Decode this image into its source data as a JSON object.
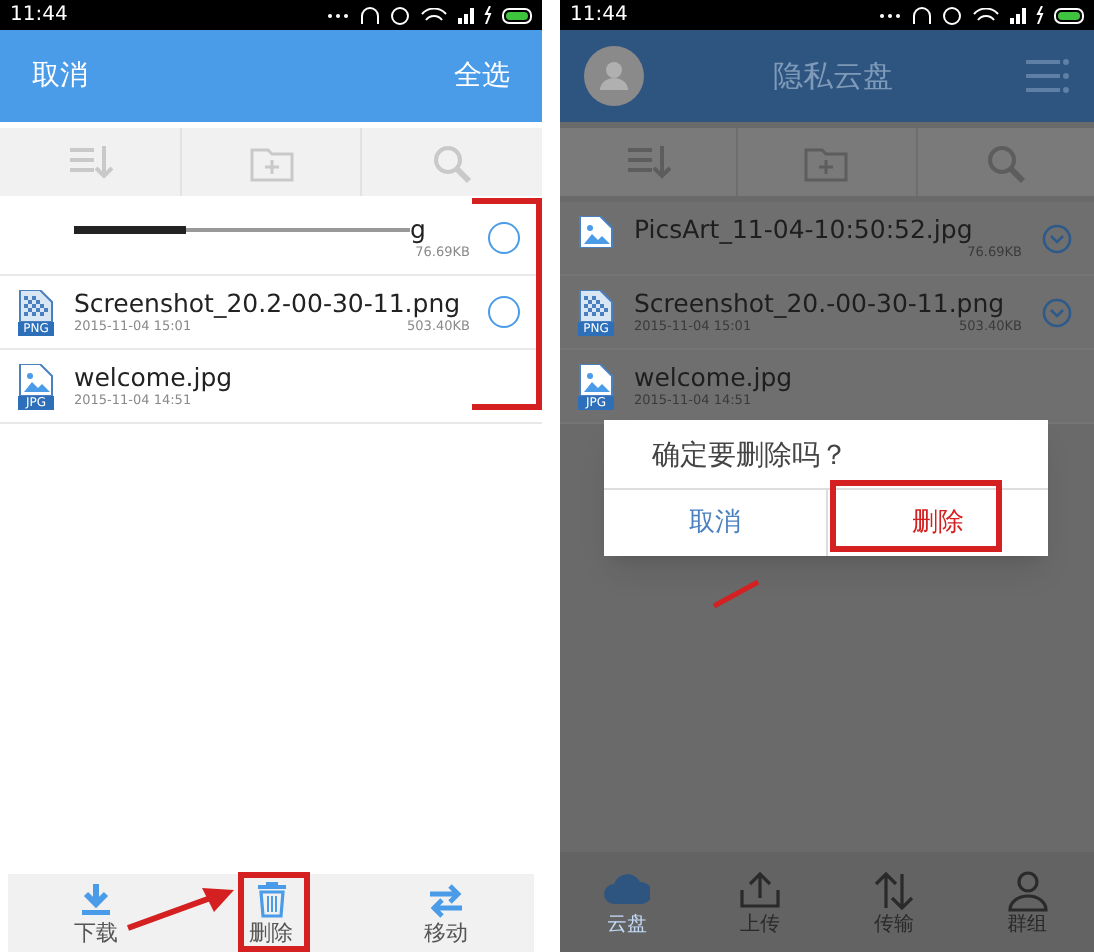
{
  "left_screen": {
    "status_bar": {
      "time": "11:44"
    },
    "header": {
      "cancel": "取消",
      "select_all": "全选"
    },
    "files": [
      {
        "kind": "glitch",
        "name": "g",
        "size": "76.69KB",
        "checked": false
      },
      {
        "kind": "png",
        "badge": "PNG",
        "name": "Screenshot_20.2-00-30-11.png",
        "date": "2015-11-04 15:01",
        "size": "503.40KB",
        "checked": false
      },
      {
        "kind": "jpg",
        "badge": "JPG",
        "name": "welcome.jpg",
        "date": "2015-11-04 14:51"
      }
    ],
    "actions": [
      {
        "kind": "download",
        "label": "下载"
      },
      {
        "kind": "delete",
        "label": "删除"
      },
      {
        "kind": "move",
        "label": "移动"
      }
    ]
  },
  "right_screen": {
    "status_bar": {
      "time": "11:44"
    },
    "title": "隐私云盘",
    "files": [
      {
        "kind": "jpg",
        "name": "PicsArt_11-04-10:50:52.jpg",
        "size": "76.69KB",
        "expandable": true
      },
      {
        "kind": "png",
        "badge": "PNG",
        "name": "Screenshot_20.-00-30-11.png",
        "date": "2015-11-04 15:01",
        "size": "503.40KB",
        "expandable": true
      },
      {
        "kind": "jpg",
        "badge": "JPG",
        "name": "welcome.jpg",
        "date": "2015-11-04 14:51",
        "expandable": false
      }
    ],
    "dialog": {
      "message": "确定要删除吗？",
      "cancel": "取消",
      "confirm": "删除"
    },
    "tabs": [
      {
        "kind": "cloud",
        "label": "云盘",
        "selected": true
      },
      {
        "kind": "upload",
        "label": "上传",
        "selected": false
      },
      {
        "kind": "transfer",
        "label": "传输",
        "selected": false
      },
      {
        "kind": "group",
        "label": "群组",
        "selected": false
      }
    ]
  }
}
